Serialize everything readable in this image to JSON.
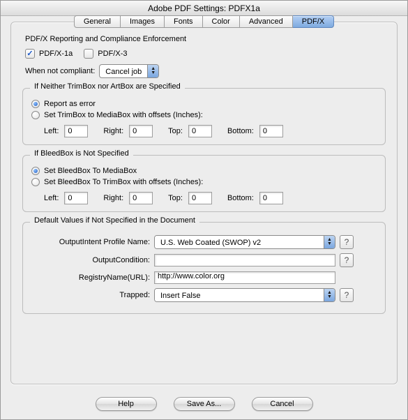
{
  "window": {
    "title": "Adobe PDF Settings: PDFX1a"
  },
  "tabs": [
    "General",
    "Images",
    "Fonts",
    "Color",
    "Advanced",
    "PDF/X"
  ],
  "active_tab_index": 5,
  "section_title": "PDF/X Reporting and Compliance Enforcement",
  "checkboxes": {
    "pdfx1a": {
      "label": "PDF/X-1a",
      "checked": true
    },
    "pdfx3": {
      "label": "PDF/X-3",
      "checked": false
    }
  },
  "when_not_compliant": {
    "label": "When not compliant:",
    "value": "Cancel job"
  },
  "group_trimbox": {
    "legend": "If Neither TrimBox nor ArtBox are Specified",
    "opt_error": {
      "label": "Report as error",
      "checked": true
    },
    "opt_settrim": {
      "label": "Set TrimBox to MediaBox with offsets (Inches):",
      "checked": false
    },
    "left": {
      "label": "Left:",
      "value": "0"
    },
    "right": {
      "label": "Right:",
      "value": "0"
    },
    "top": {
      "label": "Top:",
      "value": "0"
    },
    "bottom": {
      "label": "Bottom:",
      "value": "0"
    }
  },
  "group_bleedbox": {
    "legend": "If BleedBox is Not Specified",
    "opt_media": {
      "label": "Set BleedBox To MediaBox",
      "checked": true
    },
    "opt_trim": {
      "label": "Set BleedBox To TrimBox with offsets (Inches):",
      "checked": false
    },
    "left": {
      "label": "Left:",
      "value": "0"
    },
    "right": {
      "label": "Right:",
      "value": "0"
    },
    "top": {
      "label": "Top:",
      "value": "0"
    },
    "bottom": {
      "label": "Bottom:",
      "value": "0"
    }
  },
  "group_defaults": {
    "legend": "Default Values if Not Specified in the Document",
    "output_intent": {
      "label": "OutputIntent Profile Name:",
      "value": "U.S. Web Coated (SWOP) v2"
    },
    "output_condition": {
      "label": "OutputCondition:",
      "value": ""
    },
    "registry": {
      "label": "RegistryName(URL):",
      "value": "http://www.color.org"
    },
    "trapped": {
      "label": "Trapped:",
      "value": "Insert False"
    }
  },
  "help_glyph": "?",
  "footer": {
    "help": "Help",
    "save_as": "Save As...",
    "cancel": "Cancel"
  }
}
